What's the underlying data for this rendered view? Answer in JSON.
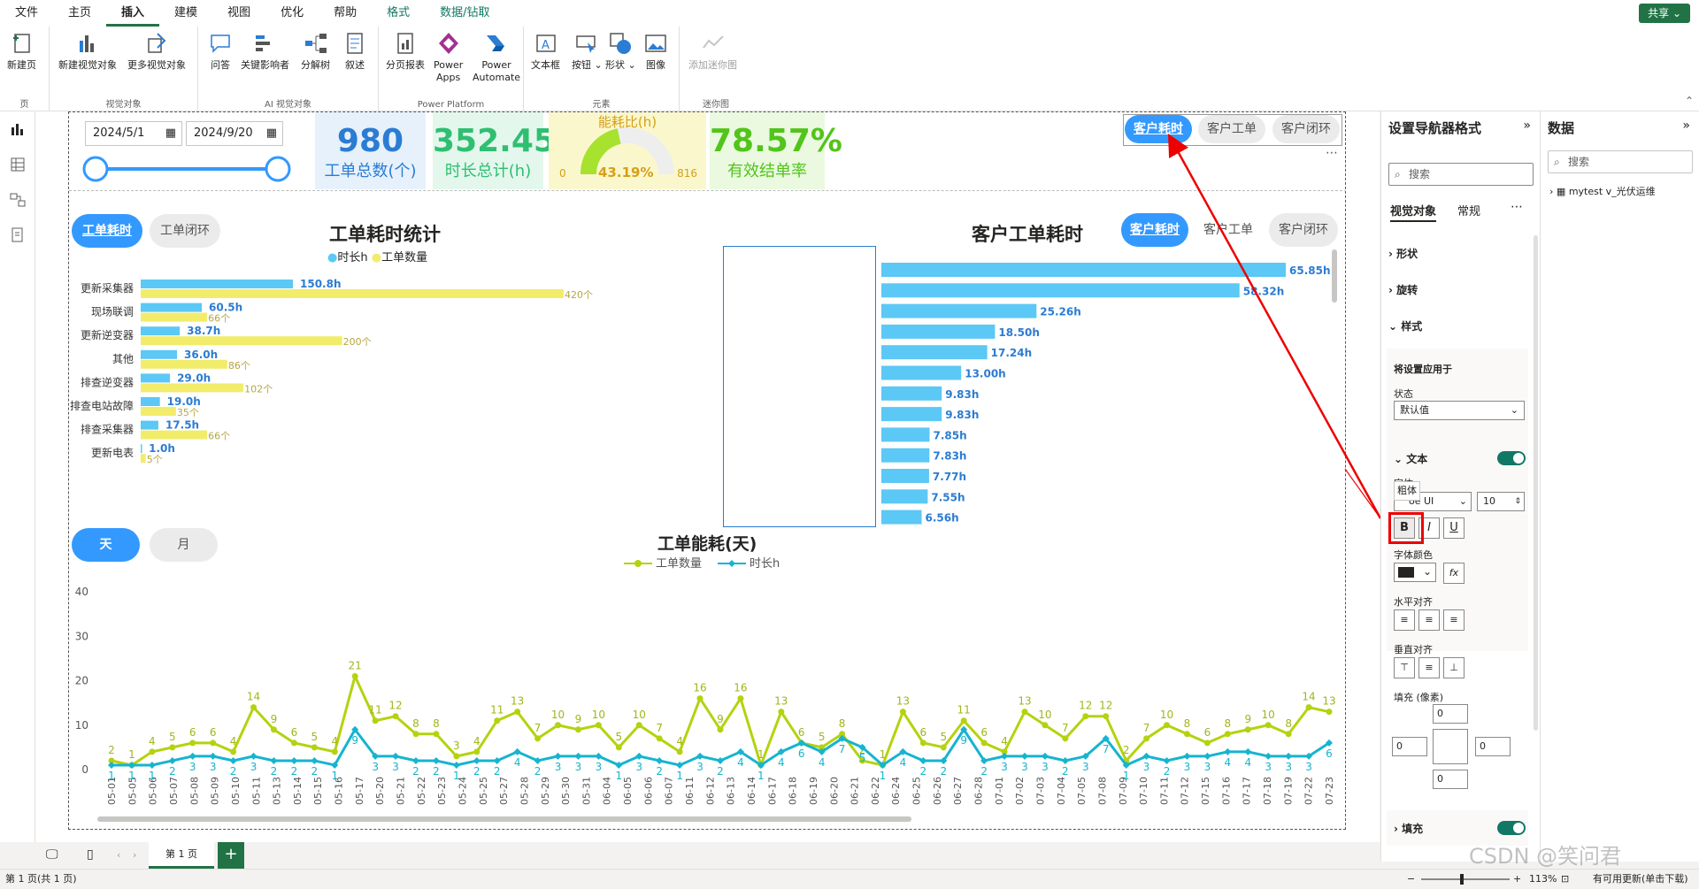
{
  "menu": [
    "文件",
    "主页",
    "插入",
    "建模",
    "视图",
    "优化",
    "帮助",
    "格式",
    "数据/钻取"
  ],
  "share": "共享",
  "ribbon": {
    "page": {
      "new_page": "新建页",
      "group": "页"
    },
    "visuals": {
      "new_visual": "新建视觉对象",
      "more_visuals": "更多视觉对象",
      "group": "视觉对象"
    },
    "ai": {
      "qa": "问答",
      "key_influencers": "关键影响者",
      "decomp": "分解树",
      "narrative": "叙述",
      "group": "AI 视觉对象"
    },
    "power": {
      "paginated": "分页报表",
      "apps1": "Power",
      "apps2": "Apps",
      "auto1": "Power",
      "auto2": "Automate",
      "group": "Power Platform"
    },
    "elements": {
      "textbox": "文本框",
      "buttons": "按钮",
      "shapes": "形状",
      "image": "图像",
      "group": "元素"
    },
    "sparkline": {
      "add": "添加迷你图",
      "group": "迷你图"
    }
  },
  "report": {
    "date_start": "2024/5/1",
    "date_end": "2024/9/20",
    "kpi": [
      {
        "value": "980",
        "label": "工单总数(个)",
        "color": "#2b7cd3",
        "bg": "#e6f1fb"
      },
      {
        "value": "352.45",
        "label": "时长总计(h)",
        "color": "#2fbf71",
        "bg": "#e4f7ed"
      },
      {
        "value": "78.57%",
        "label": "有效结单率",
        "color": "#52c41a",
        "bg": "#eaf9e0"
      }
    ],
    "gauge": {
      "title": "能耗比(h)",
      "pct": "43.19%",
      "min": "0",
      "max": "816",
      "fill": 0.4319
    },
    "nav_top": [
      "客户耗时",
      "客户工单",
      "客户闭环"
    ],
    "nav_left": [
      "工单耗时",
      "工单闭环"
    ],
    "nav_right": [
      "客户耗时",
      "客户工单",
      "客户闭环"
    ],
    "nav_bottom": [
      "天",
      "月"
    ],
    "chart_colors": {
      "hours": "#5bc8f5",
      "count": "#f2ec6b",
      "count_line": "#b5d20f",
      "hours_line": "#16b4cf"
    }
  },
  "chart_data": [
    {
      "type": "bar",
      "title": "工单耗时统计",
      "legend": [
        "时长h",
        "工单数量"
      ],
      "categories": [
        "更新采集器",
        "现场联调",
        "更新逆变器",
        "其他",
        "排查逆变器",
        "排查电站故障",
        "排查采集器",
        "更新电表"
      ],
      "series": [
        {
          "name": "时长h",
          "values": [
            150.8,
            60.5,
            38.7,
            36.0,
            29.0,
            19.0,
            17.5,
            1.0
          ],
          "labels": [
            "150.8h",
            "60.5h",
            "38.7h",
            "36.0h",
            "29.0h",
            "19.0h",
            "17.5h",
            "1.0h"
          ]
        },
        {
          "name": "工单数量",
          "values": [
            420,
            66,
            200,
            86,
            102,
            35,
            66,
            5
          ],
          "labels": [
            "420个",
            "66个",
            "200个",
            "86个",
            "102个",
            "35个",
            "66个",
            "5个"
          ]
        }
      ]
    },
    {
      "type": "bar",
      "title": "客户工单耗时",
      "values": [
        65.85,
        58.32,
        25.26,
        18.5,
        17.24,
        13.0,
        9.83,
        9.83,
        7.85,
        7.83,
        7.77,
        7.55,
        6.56
      ],
      "labels": [
        "65.85h",
        "58.32h",
        "25.26h",
        "18.50h",
        "17.24h",
        "13.00h",
        "9.83h",
        "9.83h",
        "7.85h",
        "7.83h",
        "7.77h",
        "7.55h",
        "6.56h"
      ]
    },
    {
      "type": "line",
      "title": "工单能耗(天)",
      "legend": [
        "工单数量",
        "时长h"
      ],
      "ylim": [
        0,
        40
      ],
      "yticks": [
        "0",
        "10",
        "20",
        "30",
        "40"
      ],
      "x": [
        "05-01",
        "05-05",
        "05-06",
        "05-07",
        "05-08",
        "05-09",
        "05-10",
        "05-11",
        "05-13",
        "05-14",
        "05-15",
        "05-16",
        "05-17",
        "05-20",
        "05-21",
        "05-22",
        "05-23",
        "05-24",
        "05-25",
        "05-27",
        "05-28",
        "05-29",
        "05-30",
        "05-31",
        "06-04",
        "06-05",
        "06-06",
        "06-07",
        "06-11",
        "06-12",
        "06-13",
        "06-14",
        "06-17",
        "06-18",
        "06-19",
        "06-20",
        "06-21",
        "06-22",
        "06-24",
        "06-25",
        "06-26",
        "06-27",
        "06-28",
        "07-01",
        "07-02",
        "07-03",
        "07-04",
        "07-05",
        "07-08",
        "07-09",
        "07-10",
        "07-11",
        "07-12",
        "07-15",
        "07-16",
        "07-17",
        "07-18",
        "07-19",
        "07-22",
        "07-23"
      ],
      "series": [
        {
          "name": "工单数量",
          "values": [
            2,
            1,
            4,
            5,
            6,
            6,
            4,
            14,
            9,
            6,
            5,
            4,
            21,
            11,
            12,
            8,
            8,
            3,
            4,
            11,
            13,
            7,
            10,
            9,
            10,
            5,
            10,
            7,
            4,
            16,
            9,
            16,
            1,
            13,
            6,
            5,
            8,
            2,
            1,
            13,
            6,
            5,
            11,
            6,
            4,
            13,
            10,
            7,
            12,
            12,
            2,
            7,
            10,
            8,
            6,
            8,
            9,
            10,
            8,
            14,
            13
          ],
          "labels": [
            "2",
            "1",
            "4",
            "5",
            "6",
            "6",
            "4",
            "14",
            "9",
            "6",
            "5",
            "4",
            "21",
            "11",
            "12",
            "8",
            "8",
            "3",
            "4",
            "11",
            "13",
            "7",
            "10",
            "9",
            "10",
            "5",
            "10",
            "7",
            "4",
            "16",
            "9",
            "16",
            "1",
            "13",
            "6",
            "5",
            "8",
            "2",
            "1",
            "13",
            "6",
            "5",
            "11",
            "6",
            "4",
            "13",
            "10",
            "7",
            "12",
            "12",
            "2",
            "7",
            "10",
            "8",
            "6",
            "8",
            "9",
            "10",
            "8",
            "14",
            "13"
          ]
        },
        {
          "name": "时长h",
          "values": [
            1,
            1,
            1,
            2,
            3,
            3,
            2,
            3,
            2,
            2,
            2,
            1,
            9,
            3,
            3,
            2,
            2,
            1,
            2,
            2,
            4,
            2,
            3,
            3,
            3,
            1,
            3,
            2,
            1,
            3,
            2,
            4,
            1,
            4,
            6,
            4,
            7,
            5,
            1,
            4,
            2,
            2,
            9,
            2,
            3,
            3,
            3,
            2,
            3,
            7,
            1,
            3,
            2,
            3,
            3,
            4,
            4,
            3,
            3,
            3,
            6
          ],
          "labels": [
            "1",
            "1",
            "1",
            "2",
            "3",
            "3",
            "2",
            "3",
            "2",
            "2",
            "2",
            "1",
            "9",
            "3",
            "3",
            "2",
            "2",
            "1",
            "2",
            "2",
            "4",
            "2",
            "3",
            "3",
            "3",
            "1",
            "3",
            "2",
            "1",
            "3",
            "2",
            "4",
            "1",
            "4",
            "6",
            "4",
            "7",
            "5",
            "1",
            "4",
            "2",
            "2",
            "9",
            "2",
            "3",
            "3",
            "3",
            "2",
            "3",
            "7",
            "1",
            "3",
            "2",
            "3",
            "3",
            "4",
            "4",
            "3",
            "3",
            "3",
            "6"
          ]
        }
      ]
    }
  ],
  "format_pane": {
    "title": "设置导航器格式",
    "search": "搜索",
    "tab_visual": "视觉对象",
    "tab_general": "常规",
    "sec_shape": "形状",
    "sec_rotate": "旋转",
    "sec_style": "样式",
    "apply_to": "将设置应用于",
    "state_label": "状态",
    "state_value": "默认值",
    "sec_text": "文本",
    "font_label": "字体",
    "font_value": "oe UI",
    "font_size": "10",
    "tooltip_bold": "粗体",
    "bold": "B",
    "italic": "I",
    "underline": "U",
    "font_color": "字体颜色",
    "fx": "fx",
    "h_align": "水平对齐",
    "v_align": "垂直对齐",
    "padding": "填充 (像素)",
    "pad_top": "0",
    "pad_left": "0",
    "pad_right": "0",
    "pad_bottom": "0",
    "sec_fill": "填充"
  },
  "data_pane": {
    "title": "数据",
    "search": "搜索",
    "table": "mytest v_光伏运维"
  },
  "tabs": {
    "page1": "第 1 页",
    "add": "+"
  },
  "status": {
    "left": "第 1 页(共 1 页)",
    "zoom": "113%",
    "update": "有可用更新(单击下载)"
  },
  "watermark": "CSDN @笑问君"
}
